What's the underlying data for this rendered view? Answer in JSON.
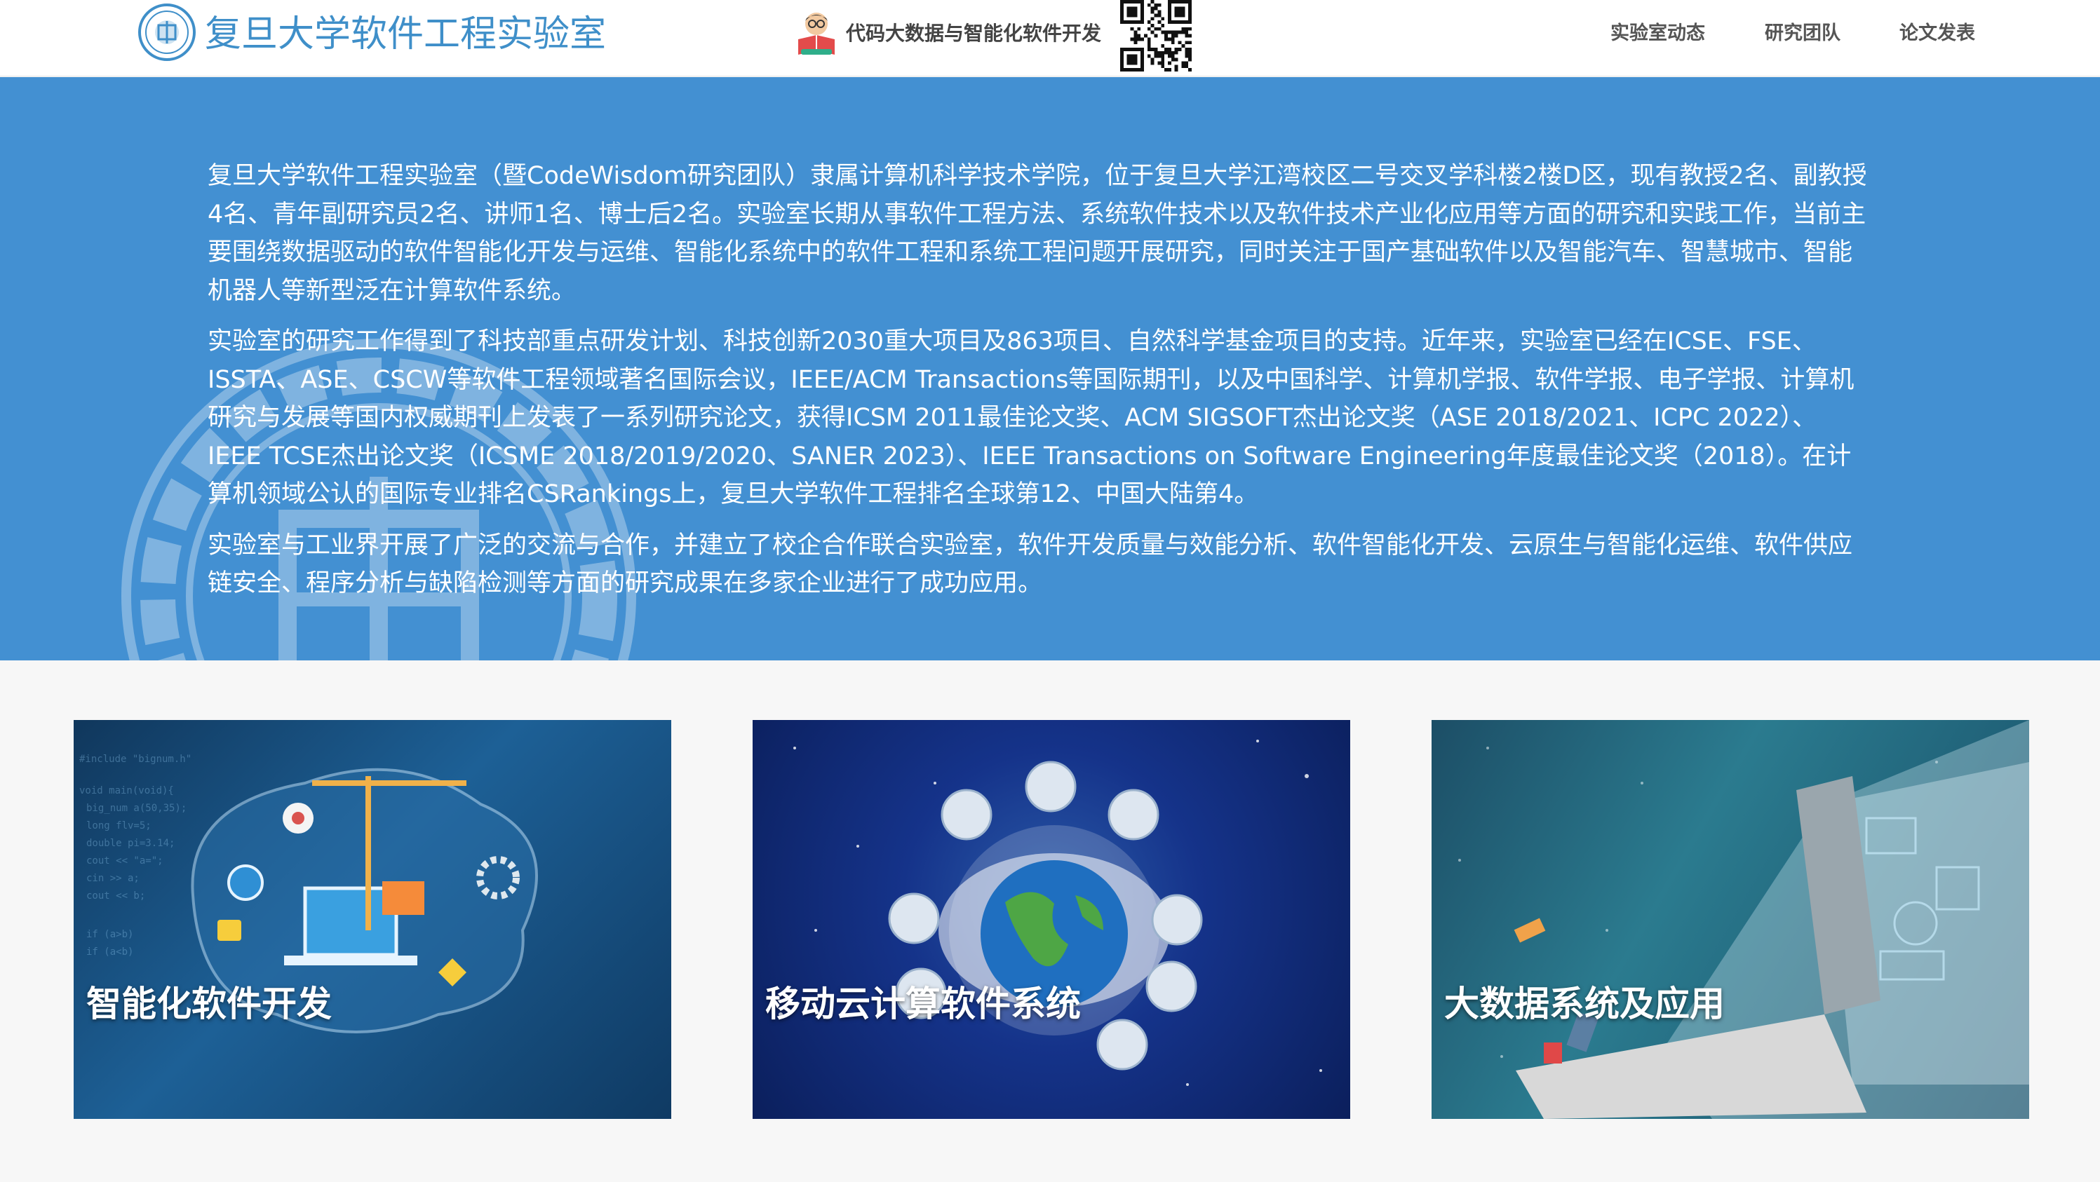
{
  "header": {
    "site_title": "复旦大学软件工程实验室",
    "wechat_label": "代码大数据与智能化软件开发",
    "nav": [
      "实验室动态",
      "研究团队",
      "论文发表"
    ]
  },
  "hero": {
    "paragraphs": [
      "复旦大学软件工程实验室（暨CodeWisdom研究团队）隶属计算机科学技术学院，位于复旦大学江湾校区二号交叉学科楼2楼D区，现有教授2名、副教授4名、青年副研究员2名、讲师1名、博士后2名。实验室长期从事软件工程方法、系统软件技术以及软件技术产业化应用等方面的研究和实践工作，当前主要围绕数据驱动的软件智能化开发与运维、智能化系统中的软件工程和系统工程问题开展研究，同时关注于国产基础软件以及智能汽车、智慧城市、智能机器人等新型泛在计算软件系统。",
      "实验室的研究工作得到了科技部重点研发计划、科技创新2030重大项目及863项目、自然科学基金项目的支持。近年来，实验室已经在ICSE、FSE、ISSTA、ASE、CSCW等软件工程领域著名国际会议，IEEE/ACM Transactions等国际期刊，以及中国科学、计算机学报、软件学报、电子学报、计算机研究与发展等国内权威期刊上发表了一系列研究论文，获得ICSM 2011最佳论文奖、ACM SIGSOFT杰出论文奖（ASE 2018/2021、ICPC 2022）、IEEE TCSE杰出论文奖（ICSME 2018/2019/2020、SANER 2023）、IEEE Transactions on Software Engineering年度最佳论文奖（2018）。在计算机领域公认的国际专业排名CSRankings上，复旦大学软件工程排名全球第12、中国大陆第4。",
      "实验室与工业界开展了广泛的交流与合作，并建立了校企合作联合实验室，软件开发质量与效能分析、软件智能化开发、云原生与智能化运维、软件供应链安全、程序分析与缺陷检测等方面的研究成果在多家企业进行了成功应用。"
    ]
  },
  "cards": [
    {
      "label": "智能化软件开发",
      "image_icon": "brain-circuit-icon"
    },
    {
      "label": "移动云计算软件系统",
      "image_icon": "globe-network-icon"
    },
    {
      "label": "大数据系统及应用",
      "image_icon": "laptop-data-icon"
    }
  ],
  "colors": {
    "accent": "#3f8fc9",
    "hero_background": "#4390d2",
    "page_background": "#f7f7f7"
  }
}
